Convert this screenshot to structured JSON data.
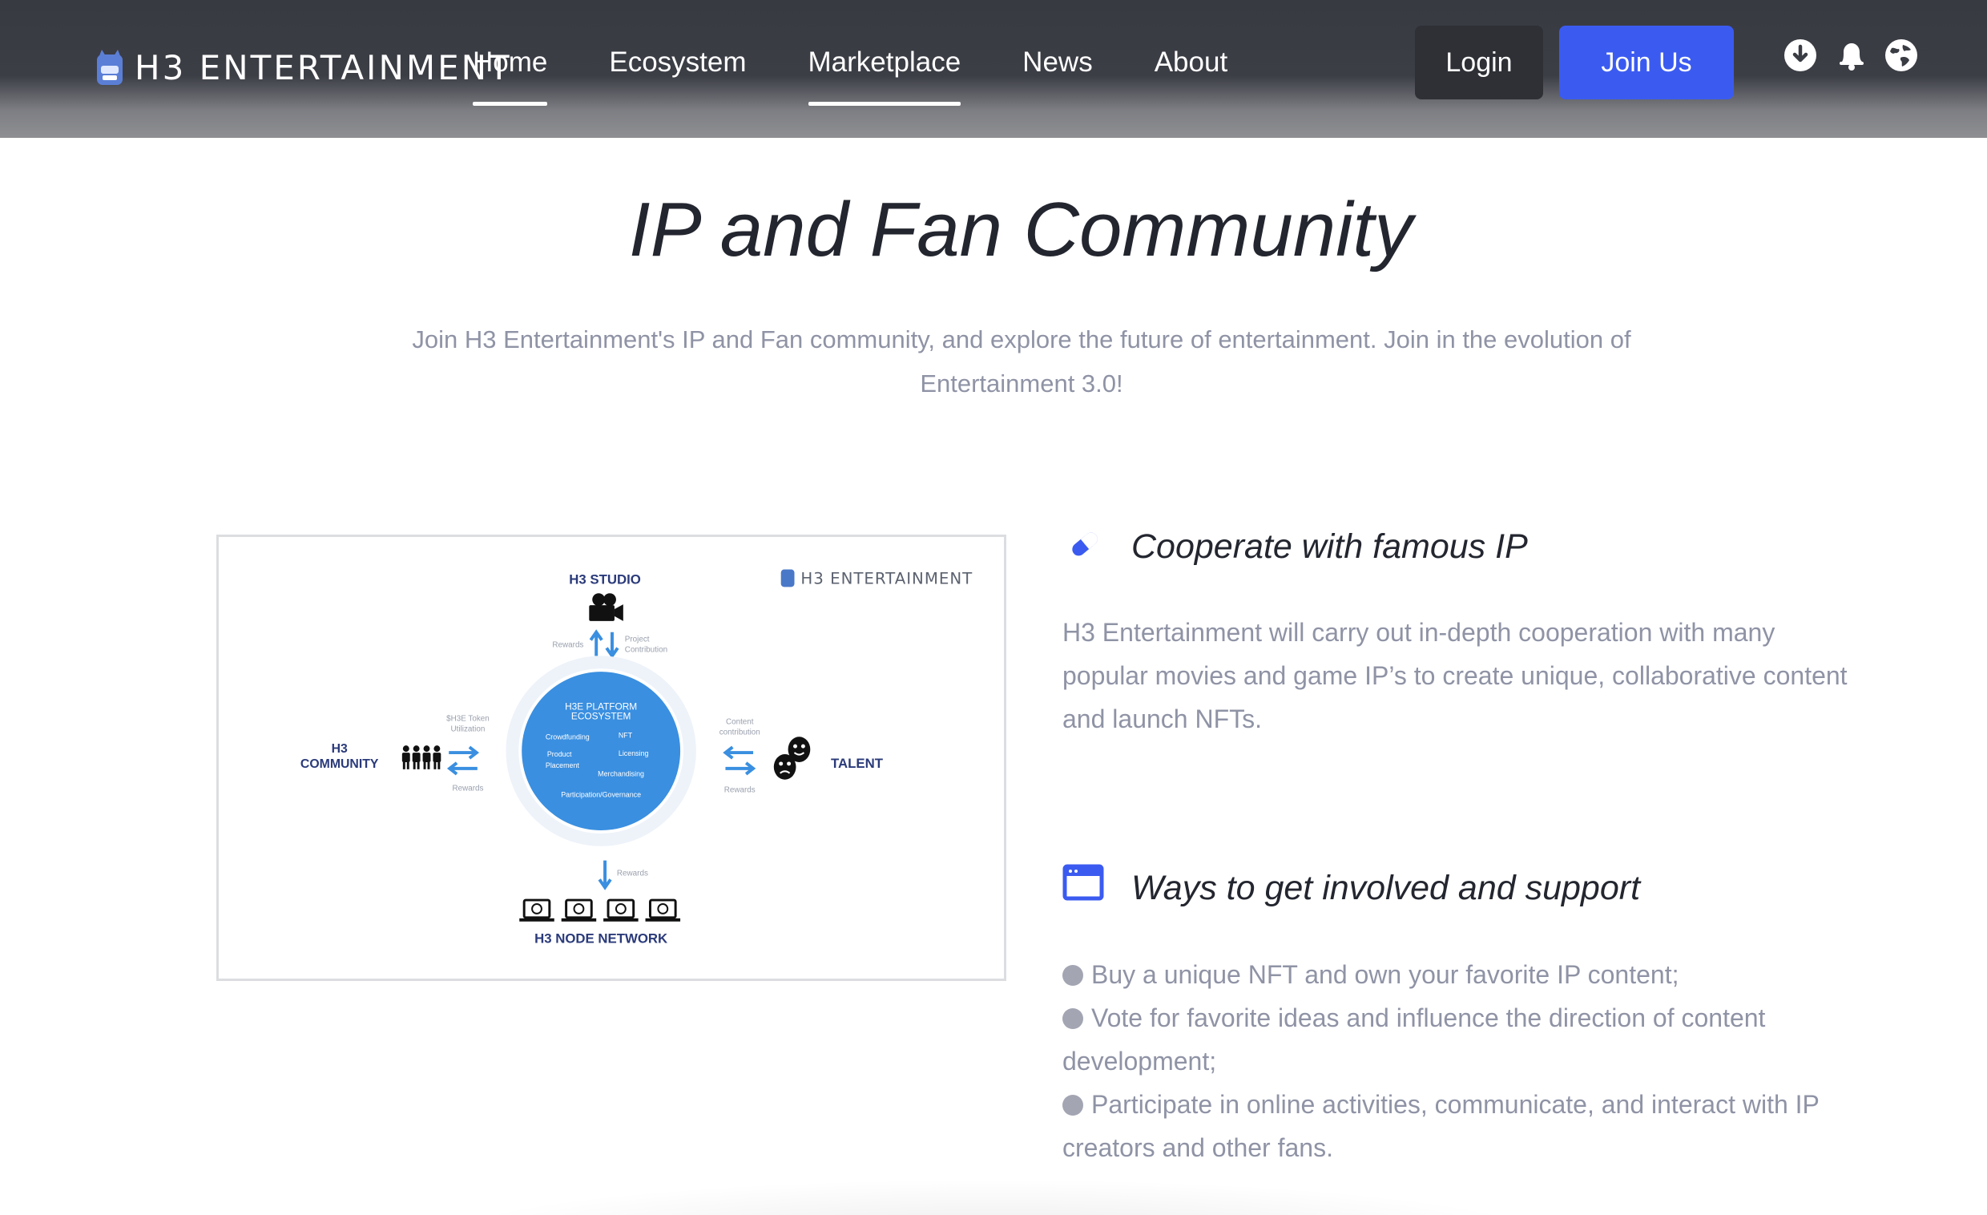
{
  "header": {
    "logo_text": "H3 ENTERTAINMENT",
    "nav": [
      {
        "label": "Home",
        "active": true
      },
      {
        "label": "Ecosystem",
        "active": false
      },
      {
        "label": "Marketplace",
        "active": true
      },
      {
        "label": "News",
        "active": false
      },
      {
        "label": "About",
        "active": false
      }
    ],
    "login_label": "Login",
    "join_label": "Join Us",
    "icons": [
      "download-icon",
      "notification-bell-icon",
      "globe-icon"
    ]
  },
  "hero": {
    "title": "IP and Fan Community",
    "subtitle": "Join H3 Entertainment's IP and Fan community, and explore the future of entertainment. Join in the evolution of Entertainment 3.0!"
  },
  "diagram": {
    "brand": "H3 ENTERTAINMENT",
    "studio": "H3 STUDIO",
    "talent": "TALENT",
    "community_line1": "H3",
    "community_line2": "COMMUNITY",
    "node_network": "H3 NODE NETWORK",
    "center_line1": "H3E PLATFORM",
    "center_line2": "ECOSYSTEM",
    "center_items": [
      "Crowdfunding",
      "NFT",
      "Product",
      "Placement",
      "Licensing",
      "Merchandising",
      "Participation/Governance"
    ],
    "studio_rewards": "Rewards",
    "studio_contrib_1": "Project",
    "studio_contrib_2": "Contribution",
    "community_token_1": "$H3E Token",
    "community_token_2": "Utilization",
    "community_rewards": "Rewards",
    "talent_contrib_1": "Content",
    "talent_contrib_2": "contribution",
    "talent_rewards": "Rewards",
    "node_rewards": "Rewards"
  },
  "features": [
    {
      "icon": "pill-icon",
      "title": "Cooperate with famous IP",
      "desc": "H3 Entertainment will carry out in-depth cooperation with many popular movies and game IP’s to create unique, collaborative content and launch NFTs."
    },
    {
      "icon": "browser-window-icon",
      "title": "Ways to get involved and support",
      "bullets": [
        "Buy a unique NFT and own your favorite IP content;",
        "Vote for favorite ideas and influence the direction of content development;",
        "Participate in online activities, communicate, and interact with IP creators and other fans."
      ]
    }
  ],
  "colors": {
    "accent": "#3b5bf0",
    "header_bg": "#3a3c44",
    "muted_text": "#8f93a5",
    "diagram_blue": "#3a8fe0"
  }
}
